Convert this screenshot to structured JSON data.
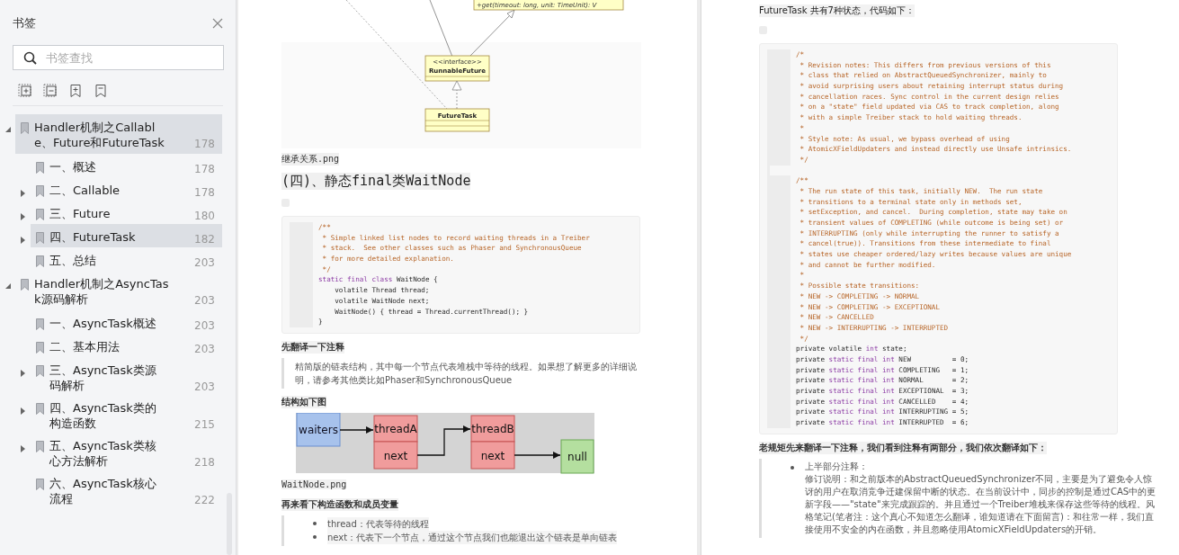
{
  "sidebar": {
    "title": "书签",
    "search": {
      "placeholder": "书签查找"
    },
    "items": [
      {
        "title": "Handler机制之Callable、Future和FutureTask",
        "page": "178",
        "expanded": true,
        "selected": true,
        "children": [
          {
            "title": "一、概述",
            "page": "178",
            "selected": false
          },
          {
            "title": "二、Callable",
            "page": "178",
            "expanded": false,
            "selected": false
          },
          {
            "title": "三、Future",
            "page": "180",
            "expanded": false,
            "selected": false
          },
          {
            "title": "四、FutureTask",
            "page": "182",
            "expanded": false,
            "selected": true
          },
          {
            "title": "五、总结",
            "page": "203",
            "selected": false
          }
        ]
      },
      {
        "title": "Handler机制之AsyncTask源码解析",
        "page": "203",
        "expanded": true,
        "selected": false,
        "children": [
          {
            "title": "一、AsyncTask概述",
            "page": "203",
            "selected": false
          },
          {
            "title": "二、基本用法",
            "page": "203",
            "selected": false
          },
          {
            "title": "三、AsyncTask类源码解析",
            "page": "203",
            "expanded": false,
            "selected": false
          },
          {
            "title": "四、AsyncTask类的构造函数",
            "page": "215",
            "expanded": false,
            "selected": false
          },
          {
            "title": "五、AsyncTask类核心方法解析",
            "page": "218",
            "expanded": false,
            "selected": false
          },
          {
            "title": "六、AsyncTask核心流程",
            "page": "222",
            "selected": false
          }
        ]
      }
    ]
  },
  "left_page": {
    "class_diagram": {
      "top_method": "+get(timeout: long, unit: TimeUnit): V",
      "interface_stereotype": "<<interface>>",
      "interface_name": "RunnableFuture",
      "class_name": "FutureTask"
    },
    "diagram_caption": "继承关系.png",
    "heading": "(四)、静态final类WaitNode",
    "code": [
      {
        "kind": "comment",
        "text": "/**"
      },
      {
        "kind": "comment",
        "text": " * Simple linked list nodes to record waiting threads in a Treiber"
      },
      {
        "kind": "comment",
        "text": " * stack.  See other classes such as Phaser and SynchronousQueue"
      },
      {
        "kind": "comment",
        "text": " * for more detailed explanation."
      },
      {
        "kind": "comment",
        "text": " */"
      },
      {
        "kind": "code",
        "parts": [
          {
            "kind": "keyword",
            "text": "static final class "
          },
          {
            "kind": "plain",
            "text": "WaitNode {"
          }
        ]
      },
      {
        "kind": "code",
        "parts": [
          {
            "kind": "plain",
            "text": "    volatile Thread thread;"
          }
        ]
      },
      {
        "kind": "code",
        "parts": [
          {
            "kind": "plain",
            "text": "    volatile WaitNode next;"
          }
        ]
      },
      {
        "kind": "code",
        "parts": [
          {
            "kind": "plain",
            "text": "    WaitNode() { thread = Thread.currentThread(); }"
          }
        ]
      },
      {
        "kind": "code",
        "parts": [
          {
            "kind": "plain",
            "text": "}"
          }
        ]
      }
    ],
    "note": "先翻译一下注释",
    "quote": "精简版的链表结构，其中每一个节点代表堆栈中等待的线程。如果想了解更多的详细说明，请参考其他类比如Phaser和SynchronousQueue",
    "structure_label": "结构如下图",
    "structure_diagram": {
      "head": "waiters",
      "nodes": [
        {
          "name": "threadA",
          "next": "next"
        },
        {
          "name": "threadB",
          "next": "next"
        }
      ],
      "end": "null"
    },
    "structure_caption": "WaitNode.png",
    "members_label": "再来看下构造函数和成员变量",
    "members": [
      "thread：代表等待的线程",
      "next：代表下一个节点，通过这个节点我们也能退出这个链表是单向链表"
    ]
  },
  "right_page": {
    "intro": "FutureTask 共有7种状态，代码如下：",
    "code": [
      {
        "kind": "comment",
        "text": "/*"
      },
      {
        "kind": "comment",
        "text": " * Revision notes: This differs from previous versions of this"
      },
      {
        "kind": "comment",
        "text": " * class that relied on AbstractQueuedSynchronizer, mainly to"
      },
      {
        "kind": "comment",
        "text": " * avoid surprising users about retaining interrupt status during"
      },
      {
        "kind": "comment",
        "text": " * cancellation races. Sync control in the current design relies"
      },
      {
        "kind": "comment",
        "text": " * on a \"state\" field updated via CAS to track completion, along"
      },
      {
        "kind": "comment",
        "text": " * with a simple Treiber stack to hold waiting threads."
      },
      {
        "kind": "comment",
        "text": " *"
      },
      {
        "kind": "comment",
        "text": " * Style note: As usual, we bypass overhead of using"
      },
      {
        "kind": "comment",
        "text": " * AtomicXFieldUpdaters and instead directly use Unsafe intrinsics."
      },
      {
        "kind": "comment",
        "text": " */"
      },
      {
        "kind": "blank"
      },
      {
        "kind": "comment",
        "text": "/**"
      },
      {
        "kind": "comment",
        "text": " * The run state of this task, initially NEW.  The run state"
      },
      {
        "kind": "comment",
        "text": " * transitions to a terminal state only in methods set,"
      },
      {
        "kind": "comment",
        "text": " * setException, and cancel.  During completion, state may take on"
      },
      {
        "kind": "comment",
        "text": " * transient values of COMPLETING (while outcome is being set) or"
      },
      {
        "kind": "comment",
        "text": " * INTERRUPTING (only while interrupting the runner to satisfy a"
      },
      {
        "kind": "comment",
        "text": " * cancel(true)). Transitions from these intermediate to final"
      },
      {
        "kind": "comment",
        "text": " * states use cheaper ordered/lazy writes because values are unique"
      },
      {
        "kind": "comment",
        "text": " * and cannot be further modified."
      },
      {
        "kind": "comment",
        "text": " *"
      },
      {
        "kind": "comment",
        "text": " * Possible state transitions:"
      },
      {
        "kind": "comment",
        "text": " * NEW -> COMPLETING -> NORMAL"
      },
      {
        "kind": "comment",
        "text": " * NEW -> COMPLETING -> EXCEPTIONAL"
      },
      {
        "kind": "comment",
        "text": " * NEW -> CANCELLED"
      },
      {
        "kind": "comment",
        "text": " * NEW -> INTERRUPTING -> INTERRUPTED"
      },
      {
        "kind": "comment",
        "text": " */"
      },
      {
        "kind": "code",
        "parts": [
          {
            "kind": "plain",
            "text": "private volatile "
          },
          {
            "kind": "keyword",
            "text": "int"
          },
          {
            "kind": "plain",
            "text": " state;"
          }
        ]
      },
      {
        "kind": "code",
        "parts": [
          {
            "kind": "plain",
            "text": "private "
          },
          {
            "kind": "keyword",
            "text": "static final int "
          },
          {
            "kind": "plain",
            "text": "NEW          = 0;"
          }
        ]
      },
      {
        "kind": "code",
        "parts": [
          {
            "kind": "plain",
            "text": "private "
          },
          {
            "kind": "keyword",
            "text": "static final int "
          },
          {
            "kind": "plain",
            "text": "COMPLETING   = 1;"
          }
        ]
      },
      {
        "kind": "code",
        "parts": [
          {
            "kind": "plain",
            "text": "private "
          },
          {
            "kind": "keyword",
            "text": "static final int "
          },
          {
            "kind": "plain",
            "text": "NORMAL       = 2;"
          }
        ]
      },
      {
        "kind": "code",
        "parts": [
          {
            "kind": "plain",
            "text": "private "
          },
          {
            "kind": "keyword",
            "text": "static final int "
          },
          {
            "kind": "plain",
            "text": "EXCEPTIONAL  = 3;"
          }
        ]
      },
      {
        "kind": "code",
        "parts": [
          {
            "kind": "plain",
            "text": "private "
          },
          {
            "kind": "keyword",
            "text": "static final int "
          },
          {
            "kind": "plain",
            "text": "CANCELLED    = 4;"
          }
        ]
      },
      {
        "kind": "code",
        "parts": [
          {
            "kind": "plain",
            "text": "private "
          },
          {
            "kind": "keyword",
            "text": "static final int "
          },
          {
            "kind": "plain",
            "text": "INTERRUPTING = 5;"
          }
        ]
      },
      {
        "kind": "code",
        "parts": [
          {
            "kind": "plain",
            "text": "private "
          },
          {
            "kind": "keyword",
            "text": "static final int "
          },
          {
            "kind": "plain",
            "text": "INTERRUPTED  = 6;"
          }
        ]
      }
    ],
    "translation_label": "老规矩先来翻译一下注释，我们看到注释有两部分，我们依次翻译如下：",
    "translation": {
      "heading": "上半部分注释：",
      "text": "修订说明：和之前版本的AbstractQueuedSynchronizer不同，主要是为了避免令人惊讶的用户在取消竞争迁建保留中断的状态。在当前设计中，同步的控制是通过CAS中的更新字段——\"state\"来完成跟踪的。并且通过一个Treiber堆栈来保存这些等待的线程。风格笔记(笔者注：这个真心不知道怎么翻译，谁知道请在下面留言)：和往常一样，我们直接使用不安全的内在函数，并且忽略使用AtomicXFieldUpdaters的开销。"
    }
  }
}
